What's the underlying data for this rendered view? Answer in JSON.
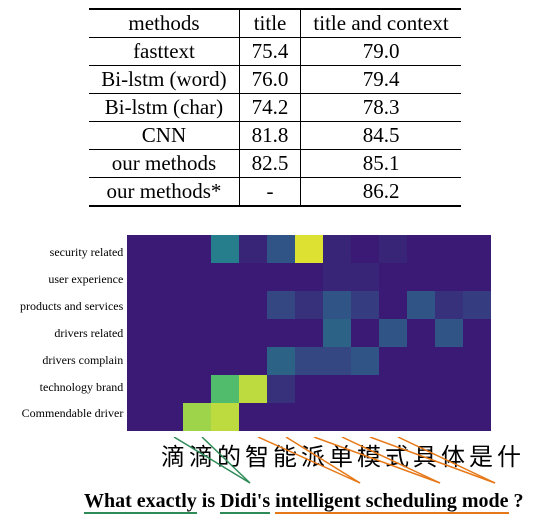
{
  "table": {
    "headers": [
      "methods",
      "title",
      "title and context"
    ],
    "rows": [
      {
        "m": "fasttext",
        "t": "75.4",
        "tc": "79.0",
        "bold": false
      },
      {
        "m": "Bi-lstm (word)",
        "t": "76.0",
        "tc": "79.4",
        "bold": false
      },
      {
        "m": "Bi-lstm (char)",
        "t": "74.2",
        "tc": "78.3",
        "bold": false
      },
      {
        "m": "CNN",
        "t": "81.8",
        "tc": "84.5",
        "bold": false
      },
      {
        "m": "our methods",
        "t": "82.5",
        "tc": "85.1",
        "bold": false
      },
      {
        "m": "our methods*",
        "t": "-",
        "tc": "86.2",
        "bold": true
      }
    ]
  },
  "chart_data": {
    "type": "heatmap",
    "title": "",
    "y_categories": [
      "security related",
      "user experience",
      "products and services",
      "drivers related",
      "drivers complain",
      "technology brand",
      "Commendable driver"
    ],
    "x_categories": [
      "滴",
      "滴",
      "的",
      "智",
      "能",
      "派",
      "单",
      "模",
      "式",
      "具",
      "体",
      "是",
      "什"
    ],
    "caption_segments": [
      {
        "text": "What exactly",
        "style": "green"
      },
      {
        "text": " is ",
        "style": "plain"
      },
      {
        "text": "Didi's",
        "style": "green"
      },
      {
        "text": " ",
        "style": "plain"
      },
      {
        "text": "intelligent scheduling mode",
        "style": "orange"
      },
      {
        "text": " ?",
        "style": "plain"
      }
    ],
    "caption_plain": "What exactly is Didi's intelligent scheduling mode ?",
    "colorscale": "viridis",
    "z": [
      [
        0.05,
        0.05,
        0.05,
        0.45,
        0.1,
        0.3,
        0.95,
        0.1,
        0.05,
        0.1,
        0.05,
        0.05,
        0.05
      ],
      [
        0.05,
        0.05,
        0.05,
        0.05,
        0.05,
        0.05,
        0.05,
        0.1,
        0.1,
        0.05,
        0.05,
        0.05,
        0.05
      ],
      [
        0.05,
        0.05,
        0.05,
        0.05,
        0.05,
        0.25,
        0.15,
        0.3,
        0.2,
        0.05,
        0.3,
        0.15,
        0.2
      ],
      [
        0.05,
        0.05,
        0.05,
        0.05,
        0.05,
        0.05,
        0.05,
        0.35,
        0.05,
        0.3,
        0.05,
        0.3,
        0.05
      ],
      [
        0.05,
        0.05,
        0.05,
        0.05,
        0.05,
        0.35,
        0.25,
        0.25,
        0.3,
        0.05,
        0.05,
        0.05,
        0.05
      ],
      [
        0.05,
        0.05,
        0.05,
        0.7,
        0.9,
        0.15,
        0.05,
        0.05,
        0.05,
        0.05,
        0.05,
        0.05,
        0.05
      ],
      [
        0.05,
        0.05,
        0.85,
        0.9,
        0.05,
        0.05,
        0.05,
        0.05,
        0.05,
        0.05,
        0.05,
        0.05,
        0.05
      ]
    ]
  }
}
